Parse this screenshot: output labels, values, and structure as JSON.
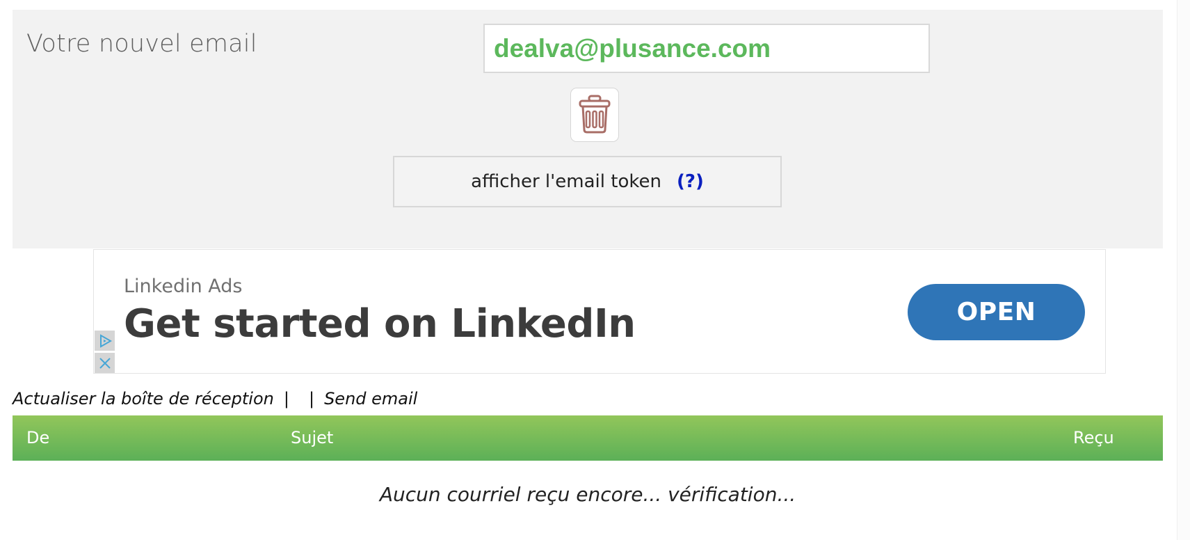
{
  "email_panel": {
    "label": "Votre nouvel email",
    "email": "dealva@plusance.com",
    "delete_icon": "trash-icon",
    "token_button_label": "afficher l'email token",
    "token_help": "(?)"
  },
  "ad": {
    "source": "Linkedin Ads",
    "headline": "Get started on LinkedIn",
    "cta": "OPEN",
    "cta_color": "#2f75b7",
    "adchoices_icon": "play-triangle-icon",
    "close_icon": "close-icon"
  },
  "links": {
    "refresh": "Actualiser la boîte de réception",
    "sep1": "|",
    "sep2": "|",
    "send": "Send email"
  },
  "inbox": {
    "columns": [
      "De",
      "Sujet",
      "Reçu"
    ],
    "empty_message": "Aucun courriel reçu encore... vérification...",
    "header_color": "#77bb58"
  },
  "colors": {
    "email_text": "#5cb85c",
    "help_link": "#0a1fbf",
    "panel_bg": "#f2f2f2"
  }
}
